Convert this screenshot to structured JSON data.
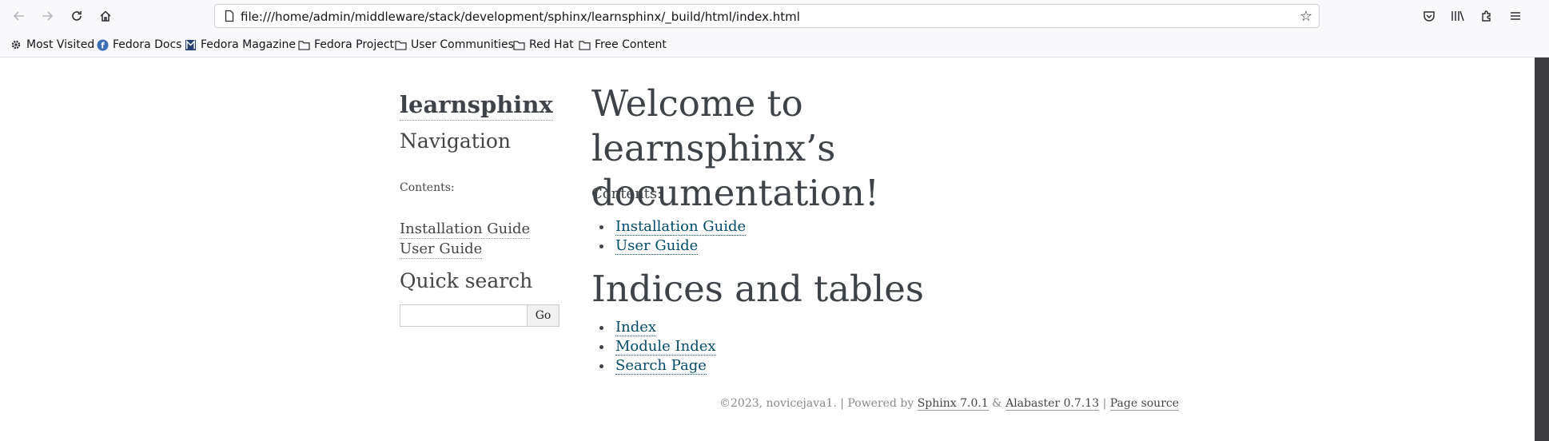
{
  "browser": {
    "url": "file:///home/admin/middleware/stack/development/sphinx/learnsphinx/_build/html/index.html",
    "bookmarks": [
      {
        "label": "Most Visited",
        "icon": "gear-icon"
      },
      {
        "label": "Fedora Docs",
        "icon": "fedora-icon"
      },
      {
        "label": "Fedora Magazine",
        "icon": "magazine-icon"
      },
      {
        "label": "Fedora Project",
        "icon": "folder-icon"
      },
      {
        "label": "User Communities",
        "icon": "folder-icon"
      },
      {
        "label": "Red Hat",
        "icon": "folder-icon"
      },
      {
        "label": "Free Content",
        "icon": "folder-icon"
      }
    ]
  },
  "sidebar": {
    "logo": "learnsphinx",
    "navigation_heading": "Navigation",
    "contents_caption": "Contents:",
    "links": [
      "Installation Guide",
      "User Guide"
    ],
    "quick_search_heading": "Quick search",
    "search_value": "",
    "go_label": "Go"
  },
  "main": {
    "title": "Welcome to learnsphinx’s documentation!",
    "contents_label": "Contents:",
    "toc": [
      "Installation Guide",
      "User Guide"
    ],
    "indices_heading": "Indices and tables",
    "indices": [
      "Index",
      "Module Index",
      "Search Page"
    ]
  },
  "footer": {
    "copyright": "©2023, novicejava1.",
    "powered_by": "Powered by",
    "sphinx_link": "Sphinx 7.0.1",
    "amp": "&",
    "alabaster_link": "Alabaster 0.7.13",
    "page_source": "Page source"
  }
}
